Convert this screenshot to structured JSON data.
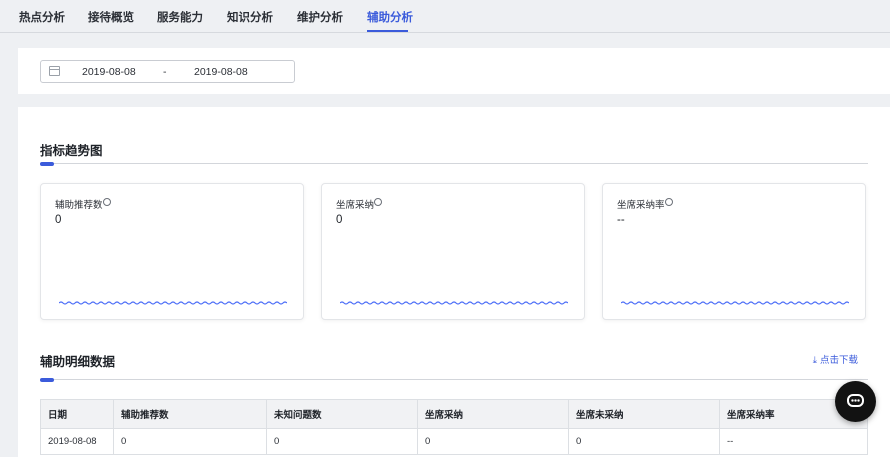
{
  "tabs": [
    {
      "label": "热点分析",
      "active": false
    },
    {
      "label": "接待概览",
      "active": false
    },
    {
      "label": "服务能力",
      "active": false
    },
    {
      "label": "知识分析",
      "active": false
    },
    {
      "label": "维护分析",
      "active": false
    },
    {
      "label": "辅助分析",
      "active": true
    }
  ],
  "date_filter": {
    "start": "2019-08-08",
    "separator": "-",
    "end": "2019-08-08",
    "icon": "calendar-icon"
  },
  "trend_section": {
    "title": "指标趋势图",
    "metrics": [
      {
        "label": "辅助推荐数",
        "value": "0"
      },
      {
        "label": "坐席采纳",
        "value": "0"
      },
      {
        "label": "坐席采纳率",
        "value": "--"
      }
    ]
  },
  "detail_section": {
    "title": "辅助明细数据",
    "download_label": "点击下载",
    "columns": [
      "日期",
      "辅助推荐数",
      "未知问题数",
      "坐席采纳",
      "坐席未采纳",
      "坐席采纳率"
    ],
    "rows": [
      [
        "2019-08-08",
        "0",
        "0",
        "0",
        "0",
        "--"
      ]
    ]
  },
  "colors": {
    "accent": "#3b5bdb",
    "sparkline": "#4a6cf7"
  }
}
